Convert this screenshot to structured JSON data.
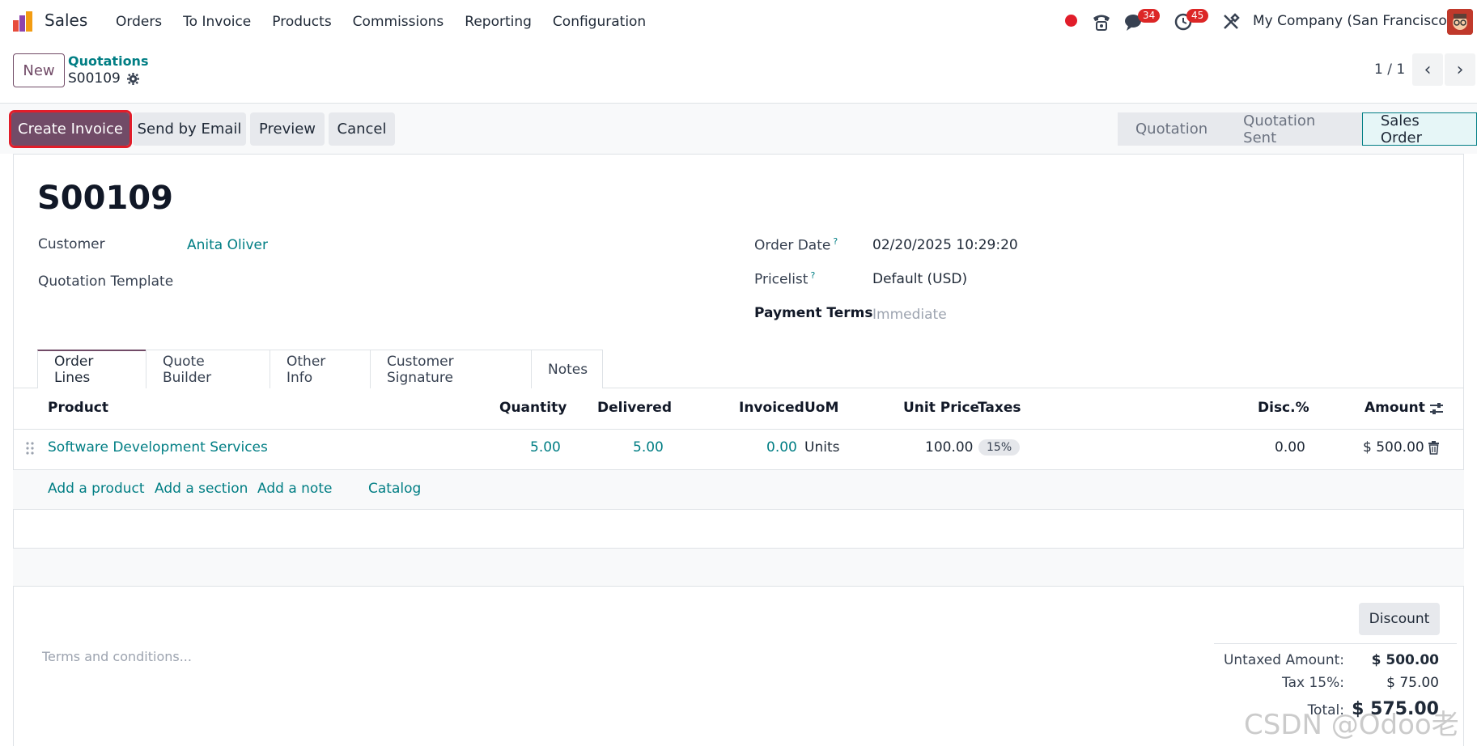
{
  "navbar": {
    "app_name": "Sales",
    "menu": [
      "Orders",
      "To Invoice",
      "Products",
      "Commissions",
      "Reporting",
      "Configuration"
    ],
    "messages_badge": "34",
    "activities_badge": "45",
    "company": "My Company (San Francisco)"
  },
  "control": {
    "new_label": "New",
    "breadcrumb_parent": "Quotations",
    "breadcrumb_current": "S00109",
    "pager": "1 / 1"
  },
  "actions": {
    "create_invoice": "Create Invoice",
    "send_email": "Send by Email",
    "preview": "Preview",
    "cancel": "Cancel"
  },
  "status": {
    "stages": [
      "Quotation",
      "Quotation Sent",
      "Sales Order"
    ],
    "active": "Sales Order"
  },
  "form": {
    "title": "S00109",
    "customer_label": "Customer",
    "customer_value": "Anita Oliver",
    "template_label": "Quotation Template",
    "order_date_label": "Order Date",
    "order_date_value": "02/20/2025 10:29:20",
    "pricelist_label": "Pricelist",
    "pricelist_value": "Default (USD)",
    "payment_terms_label": "Payment Terms",
    "payment_terms_value": "Immediate",
    "help_mark": "?"
  },
  "tabs": [
    "Order Lines",
    "Quote Builder",
    "Other Info",
    "Customer Signature",
    "Notes"
  ],
  "table": {
    "headers": {
      "product": "Product",
      "quantity": "Quantity",
      "delivered": "Delivered",
      "invoiced": "Invoiced",
      "uom": "UoM",
      "unit_price": "Unit Price",
      "taxes": "Taxes",
      "disc": "Disc.%",
      "amount": "Amount"
    },
    "row": {
      "product": "Software Development Services",
      "quantity": "5.00",
      "delivered": "5.00",
      "invoiced": "0.00",
      "uom": "Units",
      "unit_price": "100.00",
      "tax": "15%",
      "disc": "0.00",
      "amount": "$ 500.00"
    },
    "add_links": {
      "product": "Add a product",
      "section": "Add a section",
      "note": "Add a note",
      "catalog": "Catalog"
    }
  },
  "footer": {
    "terms_placeholder": "Terms and conditions...",
    "discount_label": "Discount",
    "untaxed_label": "Untaxed Amount:",
    "untaxed_value": "$ 500.00",
    "tax_label": "Tax 15%:",
    "tax_value": "$ 75.00",
    "total_label": "Total:",
    "total_value": "$ 575.00"
  },
  "watermark": "CSDN @Odoo老杨",
  "colors": {
    "brand": "#714b67",
    "link": "#017e84",
    "badge": "#dc2626"
  }
}
